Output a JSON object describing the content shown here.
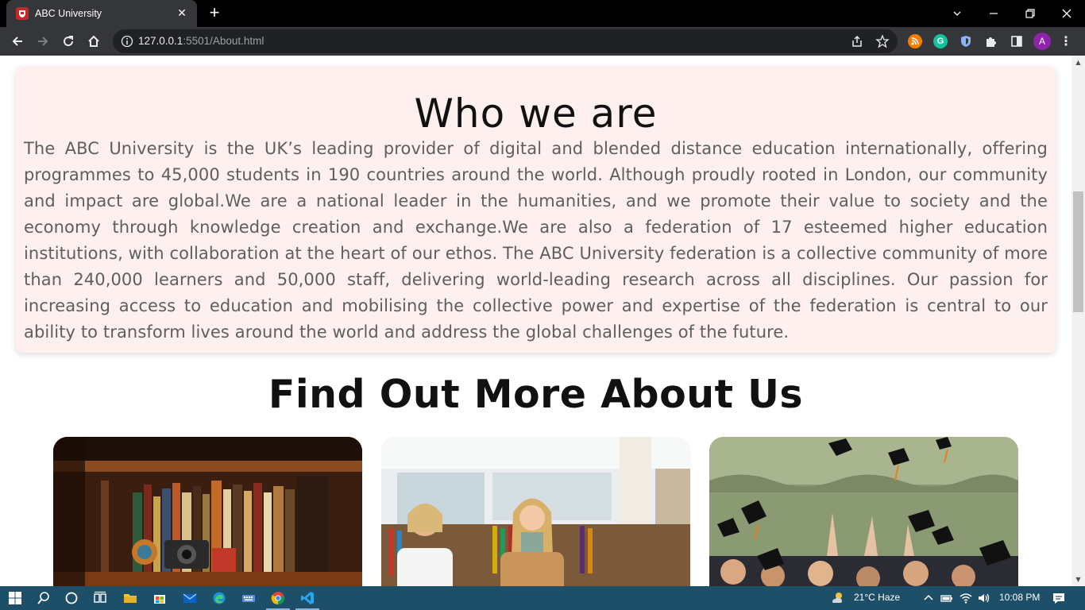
{
  "browser": {
    "tab_title": "ABC University",
    "url_host": "127.0.0.1",
    "url_rest": ":5501/About.html",
    "profile_initial": "A"
  },
  "colors": {
    "card_bg": "#fdf0ef",
    "body_text": "#5e5e5e",
    "heading": "#111111",
    "chrome_dark": "#35363a",
    "taskbar": "#1e4f68"
  },
  "about": {
    "heading": "Who we are",
    "body": "The ABC University is the UK’s leading provider of digital and blended distance education internationally, offering programmes to 45,000 students in 190 countries around the world. Although proudly rooted in London, our community and impact are global.We are a national leader in the humanities, and we promote their value to society and the economy through knowledge creation and exchange.We are also a federation of 17 esteemed higher education institutions, with collaboration at the heart of our ethos. The ABC University federation is a collective community of more than 240,000 learners and 50,000 staff, delivering world-leading research across all disciplines. Our passion for increasing access to education and mobilising the collective power and expertise of the federation is central to our ability to transform lives around the world and address the global challenges of the future."
  },
  "more": {
    "heading": "Find Out More About Us",
    "cards": [
      {
        "subject": "bookshelf-photo"
      },
      {
        "subject": "library-students-photo"
      },
      {
        "subject": "graduation-caps-photo"
      }
    ]
  },
  "taskbar": {
    "weather": "21°C  Haze",
    "time": "10:08 PM",
    "icons": [
      "windows-start-icon",
      "search-icon",
      "cortana-icon",
      "task-view-icon",
      "file-explorer-icon",
      "store-icon",
      "mail-icon",
      "edge-icon",
      "keyboard-icon",
      "chrome-icon",
      "vscode-icon"
    ]
  }
}
